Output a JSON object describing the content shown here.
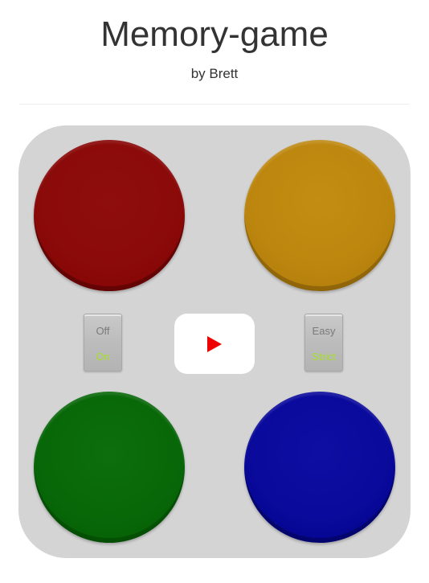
{
  "header": {
    "title": "Memory-game",
    "byline": "by Brett"
  },
  "board": {
    "pads": [
      {
        "color_name": "red",
        "color": "#8b0a0a"
      },
      {
        "color_name": "yellow",
        "color": "#bd870f"
      },
      {
        "color_name": "green",
        "color": "#086808"
      },
      {
        "color_name": "blue",
        "color": "#0a0a9c"
      }
    ],
    "power_toggle": {
      "off_label": "Off",
      "on_label": "On"
    },
    "mode_toggle": {
      "easy_label": "Easy",
      "strict_label": "Strict"
    },
    "start_button": {
      "icon": "play-icon",
      "icon_color": "#ee0000"
    }
  },
  "colors": {
    "board_background": "#d4d4d4",
    "active_option_text": "#a7e02a",
    "inactive_option_text": "#7a7a7a"
  }
}
